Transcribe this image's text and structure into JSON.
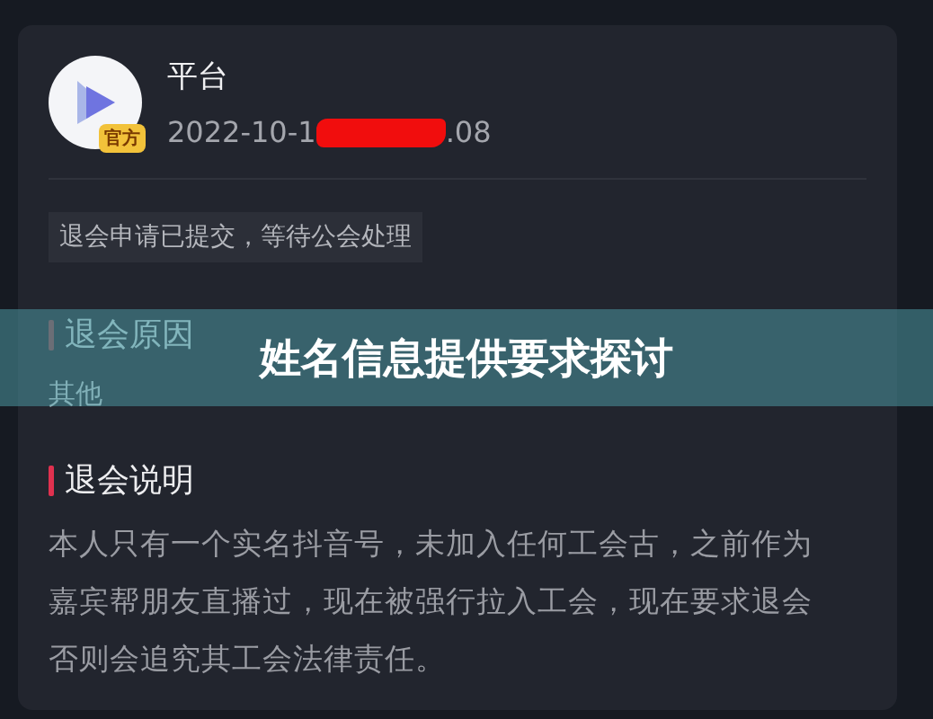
{
  "card": {
    "avatar_badge": "官方",
    "title": "平台",
    "date_start": "2022-10-1",
    "date_end": ".08",
    "date_redacted": true,
    "status_tag": "退会申请已提交，等待公会处理",
    "sections": [
      {
        "heading": "退会原因",
        "color": "#6b6e76",
        "body": "其他",
        "kind": "short"
      },
      {
        "heading": "退会说明",
        "color": "#e0314f",
        "body": "本人只有一个实名抖音号，未加入任何工会古，之前作为嘉宾帮朋友直播过，现在被强行拉入工会，现在要求退会否则会追究其工会法律责任。",
        "kind": "long"
      }
    ]
  },
  "banner": {
    "text": "姓名信息提供要求探讨"
  }
}
